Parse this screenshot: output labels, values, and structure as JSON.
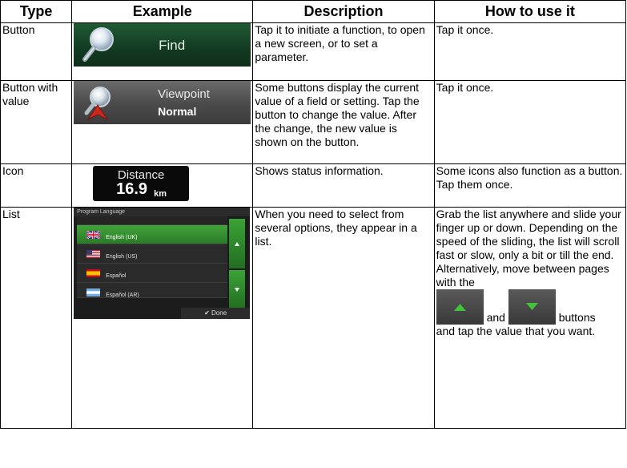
{
  "headers": [
    "Type",
    "Example",
    "Description",
    "How to use it"
  ],
  "rows": [
    {
      "type": "Button",
      "example": {
        "label": "Find",
        "icon": "magnifier-icon"
      },
      "description": "Tap it to initiate a function, to open a new screen, or to set a parameter.",
      "how": "Tap it once."
    },
    {
      "type": "Button with value",
      "example": {
        "label": "Viewpoint",
        "value": "Normal",
        "icon": "viewpoint-icon"
      },
      "description": "Some buttons display the current value of a field or setting. Tap the button to change the value. After the change, the new value is shown on the button.",
      "how": "Tap it once."
    },
    {
      "type": "Icon",
      "example": {
        "label": "Distance",
        "value": "16.9",
        "unit": "km"
      },
      "description": "Shows status information.",
      "how": "Some icons also function as a button. Tap them once."
    },
    {
      "type": "List",
      "example": {
        "title": "Program Language",
        "items": [
          {
            "label": "English (UK)",
            "flag": "uk-flag-icon",
            "selected": true
          },
          {
            "label": "English (US)",
            "flag": "us-flag-icon",
            "selected": false
          },
          {
            "label": "Español",
            "flag": "spain-flag-icon",
            "selected": false
          },
          {
            "label": "Español (AR)",
            "flag": "argentina-flag-icon",
            "selected": false
          }
        ],
        "done_label": "Done"
      },
      "description": "When you need to select from several options, they appear in a list.",
      "how_before": "Grab the list anywhere and slide your finger up or down. Depending on the speed of the sliding, the list will scroll fast or slow, only a bit or till the end. Alternatively, move between pages with the",
      "how_and": "and",
      "how_buttons": "buttons",
      "how_after": "and tap the value that you want."
    }
  ],
  "colors": {
    "accent_green": "#3aa336",
    "find_bg": "#1f5a33",
    "icon_bg": "#0a0a0a"
  }
}
